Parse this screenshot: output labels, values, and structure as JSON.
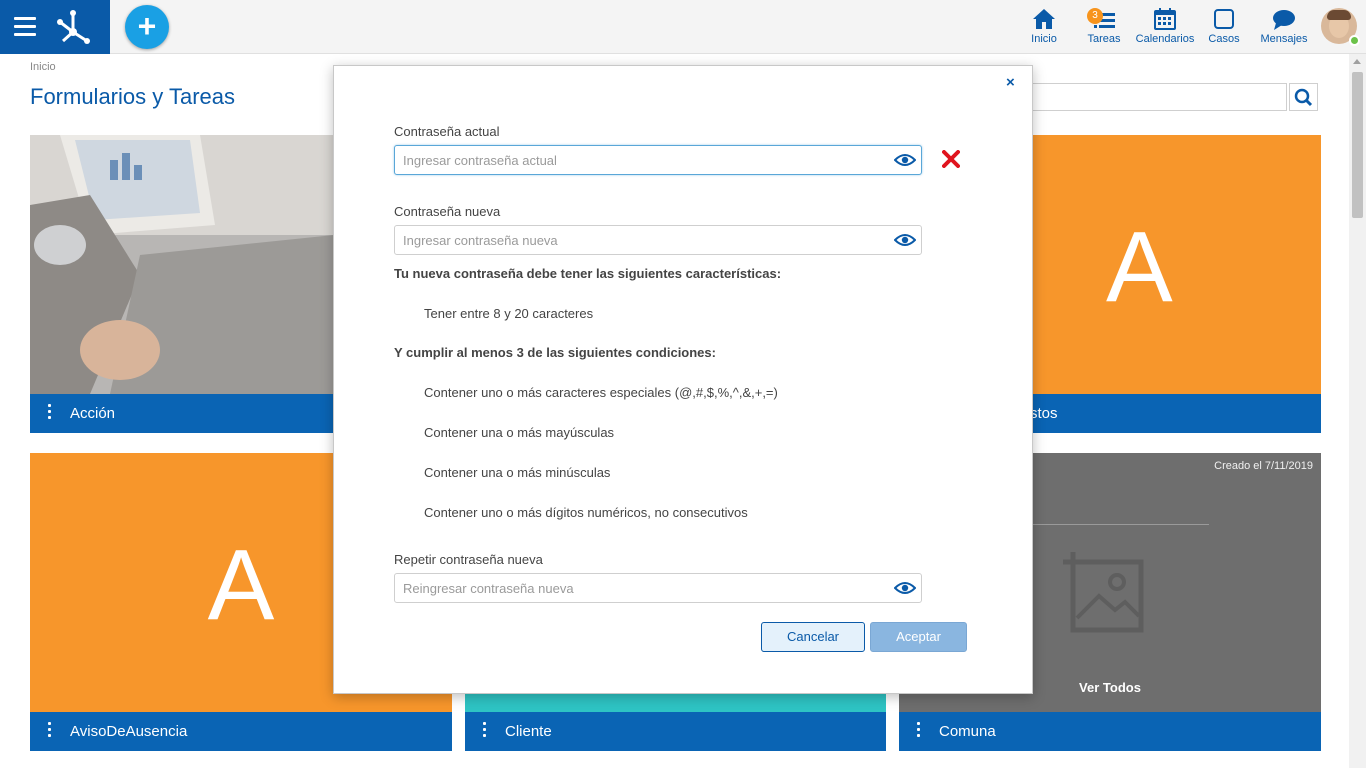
{
  "topbar": {
    "nav": [
      {
        "label": "Inicio",
        "icon": "home-icon"
      },
      {
        "label": "Tareas",
        "icon": "tasks-icon",
        "badge": "3"
      },
      {
        "label": "Calendarios",
        "icon": "calendar-icon"
      },
      {
        "label": "Casos",
        "icon": "case-icon"
      },
      {
        "label": "Mensajes",
        "icon": "messages-icon"
      }
    ],
    "add_label": "+"
  },
  "page": {
    "breadcrumb": "Inicio",
    "title": "Formularios y Tareas"
  },
  "cards": [
    {
      "name": "Acción",
      "type": "image"
    },
    {
      "name": "stos",
      "type": "letter",
      "letter": "A",
      "color": "#f7962b"
    },
    {
      "name": "AvisoDeAusencia",
      "type": "letter",
      "letter": "A",
      "color": "#f7962b"
    },
    {
      "name": "Cliente",
      "type": "color",
      "color": "#2ec4c4"
    },
    {
      "name": "Comuna",
      "type": "placeholder",
      "created": "Creado el 7/11/2019",
      "view_all": "Ver Todos"
    }
  ],
  "modal": {
    "close": "×",
    "current": {
      "label": "Contraseña actual",
      "placeholder": "Ingresar contraseña actual"
    },
    "new": {
      "label": "Contraseña nueva",
      "placeholder": "Ingresar contraseña nueva"
    },
    "rules_heading": "Tu nueva contraseña debe tener las siguientes características:",
    "rule_length": "Tener entre 8 y 20 caracteres",
    "conditions_heading": "Y cumplir al menos 3 de las siguientes condiciones:",
    "conditions": [
      "Contener uno o más caracteres especiales (@,#,$,%,^,&,+,=)",
      "Contener una o más mayúsculas",
      "Contener una o más minúsculas",
      "Contener uno o más dígitos numéricos, no consecutivos"
    ],
    "repeat": {
      "label": "Repetir contraseña nueva",
      "placeholder": "Reingresar contraseña nueva"
    },
    "cancel": "Cancelar",
    "accept": "Aceptar"
  },
  "colors": {
    "brand": "#0a5aa8",
    "accent": "#1aa0e4",
    "orange": "#f7962b",
    "teal": "#2ec4c4",
    "error": "#e0141e"
  }
}
